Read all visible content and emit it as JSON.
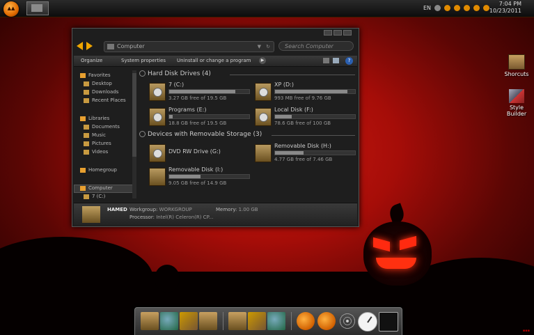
{
  "taskbar": {
    "language": "EN",
    "time": "7:04 PM",
    "date": "10/23/2011"
  },
  "desktop_icons": [
    {
      "label": "Shorcuts"
    },
    {
      "label": "Style Builder"
    }
  ],
  "explorer": {
    "address": "Computer",
    "search_placeholder": "Search Computer",
    "commands": [
      "Organize",
      "System properties",
      "Uninstall or change a program"
    ],
    "nav": [
      {
        "label": "Favorites",
        "header": true
      },
      {
        "label": "Desktop"
      },
      {
        "label": "Downloads"
      },
      {
        "label": "Recent Places"
      },
      {
        "label": "Libraries",
        "header": true
      },
      {
        "label": "Documents"
      },
      {
        "label": "Music"
      },
      {
        "label": "Pictures"
      },
      {
        "label": "Videos"
      },
      {
        "label": "Homegroup",
        "header": true
      },
      {
        "label": "Computer",
        "header": true,
        "selected": true
      },
      {
        "label": "7 (C:)"
      }
    ],
    "groups": [
      {
        "title": "Hard Disk Drives (4)"
      },
      {
        "title": "Devices with Removable Storage (3)"
      }
    ],
    "drives": [
      {
        "name": "7 (C:)",
        "free": "3.27 GB free of 19.5 GB",
        "used_fraction": 0.83
      },
      {
        "name": "XP (D:)",
        "free": "993 MB free of 9.76 GB",
        "used_fraction": 0.9
      },
      {
        "name": "Programs (E:)",
        "free": "18.8 GB free of 19.5 GB",
        "used_fraction": 0.04
      },
      {
        "name": "Local Disk (F:)",
        "free": "78.6 GB free of 100 GB",
        "used_fraction": 0.21
      },
      {
        "name": "DVD RW Drive (G:)",
        "free": "",
        "used_fraction": null
      },
      {
        "name": "Removable Disk (H:)",
        "free": "4.77 GB free of 7.46 GB",
        "used_fraction": 0.36
      },
      {
        "name": "Removable Disk (I:)",
        "free": "9.05 GB free of 14.9 GB",
        "used_fraction": 0.39
      }
    ],
    "details": {
      "name": "HAMED",
      "workgroup_label": "Workgroup:",
      "workgroup": "WORKGROUP",
      "memory_label": "Memory:",
      "memory": "1.00 GB",
      "processor_label": "Processor:",
      "processor": "Intel(R) Celeron(R) CP..."
    }
  },
  "colors": {
    "accent": "#f0a500",
    "background_red": "#b00f0a"
  }
}
